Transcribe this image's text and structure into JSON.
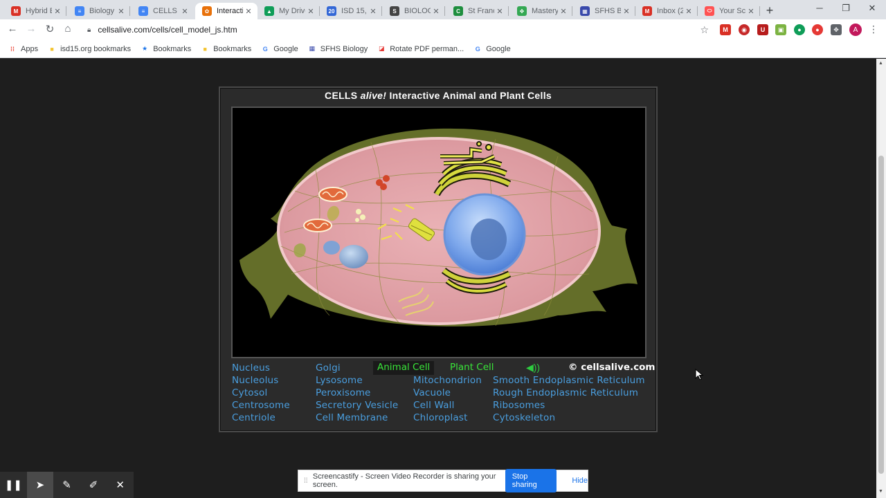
{
  "browser": {
    "tabs": [
      {
        "title": "Hybrid B",
        "icon": "gmail-icon",
        "color": "#d93025",
        "glyph": "M"
      },
      {
        "title": "Biology",
        "icon": "docs-icon",
        "color": "#4285f4",
        "glyph": "≡"
      },
      {
        "title": "CELLS al",
        "icon": "docs-icon",
        "color": "#4285f4",
        "glyph": "≡"
      },
      {
        "title": "Interacti",
        "icon": "cellsalive-icon",
        "color": "#e8710a",
        "glyph": "✿"
      },
      {
        "title": "My Drive",
        "icon": "drive-icon",
        "color": "#0f9d58",
        "glyph": "▲"
      },
      {
        "title": "ISD 15, S",
        "icon": "calendar-icon",
        "color": "#3367d6",
        "glyph": "20"
      },
      {
        "title": "BIOLOGY",
        "icon": "safari-icon",
        "color": "#444444",
        "glyph": "S"
      },
      {
        "title": "St Franc",
        "icon": "classroom-icon",
        "color": "#1e8e3e",
        "glyph": "C"
      },
      {
        "title": "Mastery",
        "icon": "puzzle-icon",
        "color": "#34a853",
        "glyph": "✥"
      },
      {
        "title": "SFHS Bi",
        "icon": "grid-icon",
        "color": "#3949ab",
        "glyph": "▦"
      },
      {
        "title": "Inbox (2",
        "icon": "gmail-icon",
        "color": "#d93025",
        "glyph": "M"
      },
      {
        "title": "Your Sc",
        "icon": "screencastify-icon",
        "color": "#ff5252",
        "glyph": "⬭"
      }
    ],
    "active_tab": 3,
    "url": "cellsalive.com/cells/cell_model_js.htm",
    "bookmarks": [
      {
        "label": "Apps",
        "icon": "apps-icon",
        "color": "#ea4335",
        "glyph": "⁞⁞"
      },
      {
        "label": "isd15.org bookmarks",
        "icon": "folder-icon",
        "color": "#f4c430",
        "glyph": "■"
      },
      {
        "label": "Bookmarks",
        "icon": "star-icon",
        "color": "#1a73e8",
        "glyph": "★"
      },
      {
        "label": "Bookmarks",
        "icon": "folder-icon",
        "color": "#f4c430",
        "glyph": "■"
      },
      {
        "label": "Google",
        "icon": "google-icon",
        "color": "#4285f4",
        "glyph": "G"
      },
      {
        "label": "SFHS Biology",
        "icon": "grid-icon",
        "color": "#3949ab",
        "glyph": "▦"
      },
      {
        "label": "Rotate PDF perman...",
        "icon": "pdf-icon",
        "color": "#e53935",
        "glyph": "◪"
      },
      {
        "label": "Google",
        "icon": "google-icon",
        "color": "#4285f4",
        "glyph": "G"
      }
    ],
    "profile_initial": "A"
  },
  "app": {
    "title_prefix": "CELLS",
    "title_italic": "alive!",
    "title_suffix": "Interactive Animal and Plant Cells",
    "modes": {
      "animal": "Animal Cell",
      "plant": "Plant Cell",
      "selected": "animal"
    },
    "credit": "© cellsalive.com",
    "links": {
      "col1": [
        "Nucleus",
        "Nucleolus",
        "Cytosol",
        "Centrosome",
        "Centriole"
      ],
      "col2": [
        "Golgi",
        "Lysosome",
        "Peroxisome",
        "Secretory Vesicle",
        "Cell Membrane"
      ],
      "col3": [
        "Mitochondrion",
        "Vacuole",
        "Cell Wall",
        "Chloroplast"
      ],
      "col4": [
        "Smooth Endoplasmic Reticulum",
        "Rough Endoplasmic Reticulum",
        "Ribosomes",
        "Cytoskeleton"
      ]
    },
    "colors": {
      "link": "#4a9fe0",
      "mode": "#39e639",
      "cytoplasm": "#e8a3a8",
      "nucleus": "#8fb8f0"
    }
  },
  "screencastify": {
    "message": "Screencastify - Screen Video Recorder is sharing your screen.",
    "stop_label": "Stop sharing",
    "hide_label": "Hide"
  }
}
